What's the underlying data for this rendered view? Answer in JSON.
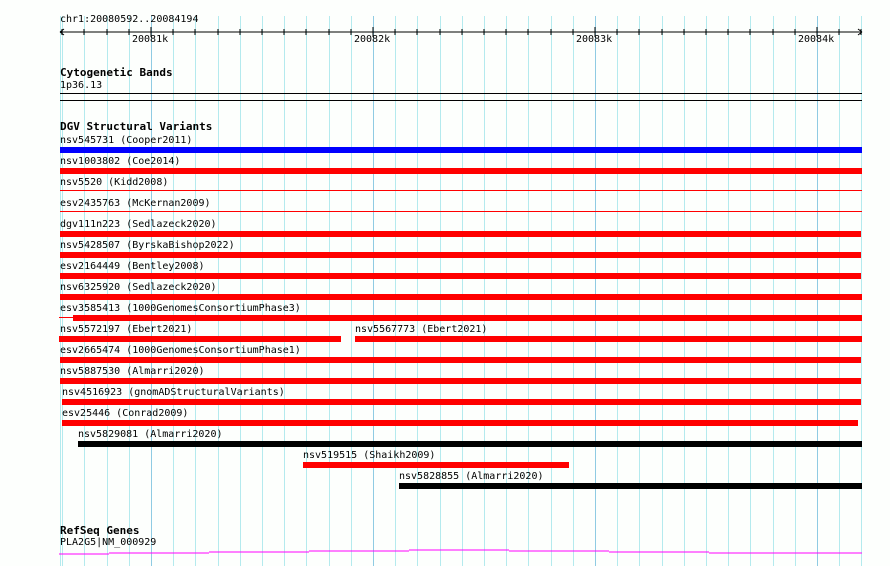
{
  "ruler": {
    "region": "chr1:20080592..20084194",
    "ticks": [
      "20081k",
      "20082k",
      "20083k",
      "20084k"
    ]
  },
  "tracks": {
    "cyto": {
      "title": "Cytogenetic Bands",
      "band": "1p36.13"
    },
    "dgv": {
      "title": "DGV Structural Variants",
      "features": [
        {
          "label": "nsv545731 (Cooper2011)",
          "color": "#0000ff"
        },
        {
          "label": "nsv1003802 (Coe2014)",
          "color": "#ff0000"
        },
        {
          "label": "nsv5520 (Kidd2008)",
          "color": "#ff0000"
        },
        {
          "label": "esv2435763 (McKernan2009)",
          "color": "#ff0000"
        },
        {
          "label": "dgv111n223 (Sedlazeck2020)",
          "color": "#ff0000"
        },
        {
          "label": "nsv5428507 (ByrskaBishop2022)",
          "color": "#ff0000"
        },
        {
          "label": "esv2164449 (Bentley2008)",
          "color": "#ff0000"
        },
        {
          "label": "nsv6325920 (Sedlazeck2020)",
          "color": "#ff0000"
        },
        {
          "label": "esv3585413 (1000GenomesConsortiumPhase3)",
          "color": "#ff0000"
        },
        {
          "label": "nsv5572197 (Ebert2021)",
          "color": "#ff0000"
        },
        {
          "label": "nsv5567773 (Ebert2021)",
          "color": "#ff0000"
        },
        {
          "label": "esv2665474 (1000GenomesConsortiumPhase1)",
          "color": "#ff0000"
        },
        {
          "label": "nsv5887530 (Almarri2020)",
          "color": "#ff0000"
        },
        {
          "label": "nsv4516923 (gnomADStructuralVariants)",
          "color": "#ff0000"
        },
        {
          "label": "esv25446 (Conrad2009)",
          "color": "#ff0000"
        },
        {
          "label": "nsv5829081 (Almarri2020)",
          "color": "#000000"
        },
        {
          "label": "nsv519515 (Shaikh2009)",
          "color": "#ff0000"
        },
        {
          "label": "nsv5828855 (Almarri2020)",
          "color": "#000000"
        }
      ]
    },
    "refseq": {
      "title": "RefSeq Genes",
      "gene": "PLA2G5|NM_000929",
      "color": "#ff00ff"
    }
  }
}
